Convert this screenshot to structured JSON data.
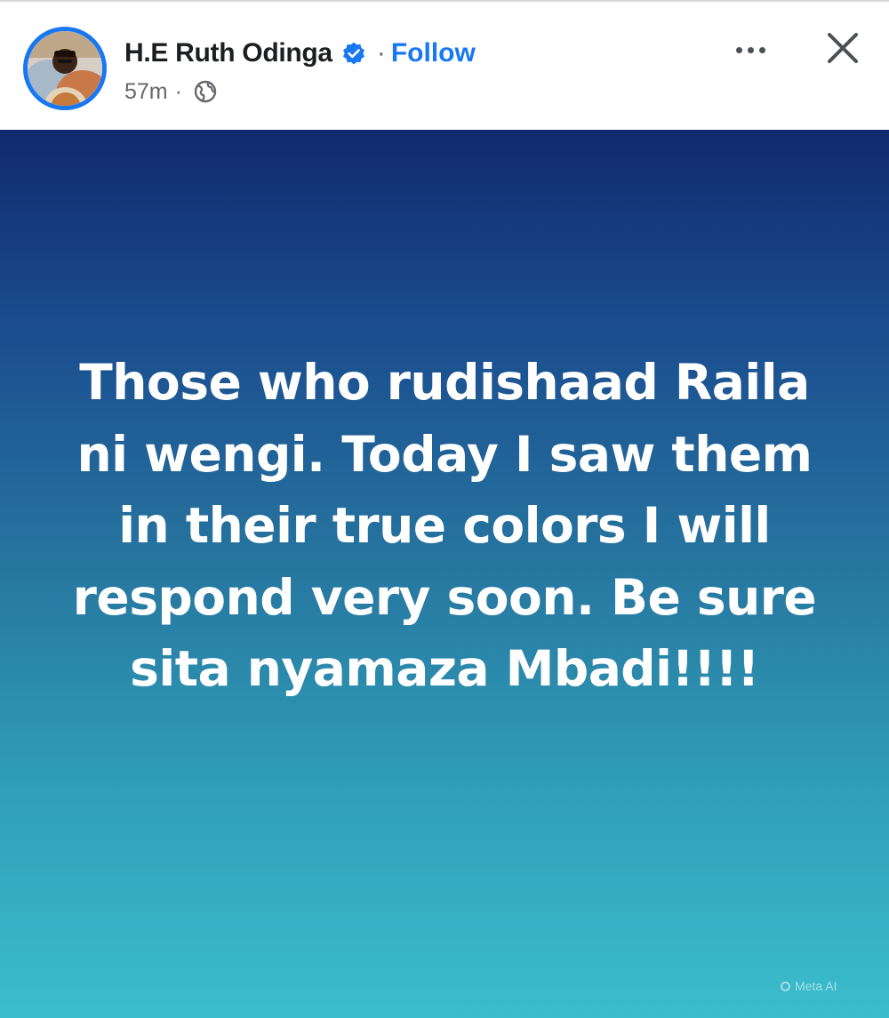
{
  "header": {
    "author_name": "H.E Ruth Odinga",
    "separator": "·",
    "follow_label": "Follow",
    "timestamp": "57m",
    "meta_separator": "·",
    "audience_icon": "globe-icon",
    "verified_icon": "verified-badge-icon",
    "more_icon": "more-options-icon",
    "close_icon": "close-icon"
  },
  "post": {
    "text": "Those who rudishaad Raila ni wengi. Today I saw them in their true colors I will respond very soon. Be sure sita nyamaza Mbadi!!!!"
  },
  "watermark": {
    "label": "Meta AI"
  },
  "colors": {
    "brand_blue": "#1877f2",
    "background_top": "#112a6e",
    "background_bottom": "#3bbdcc",
    "text_primary": "#1c1e21",
    "text_secondary": "#65676b"
  }
}
